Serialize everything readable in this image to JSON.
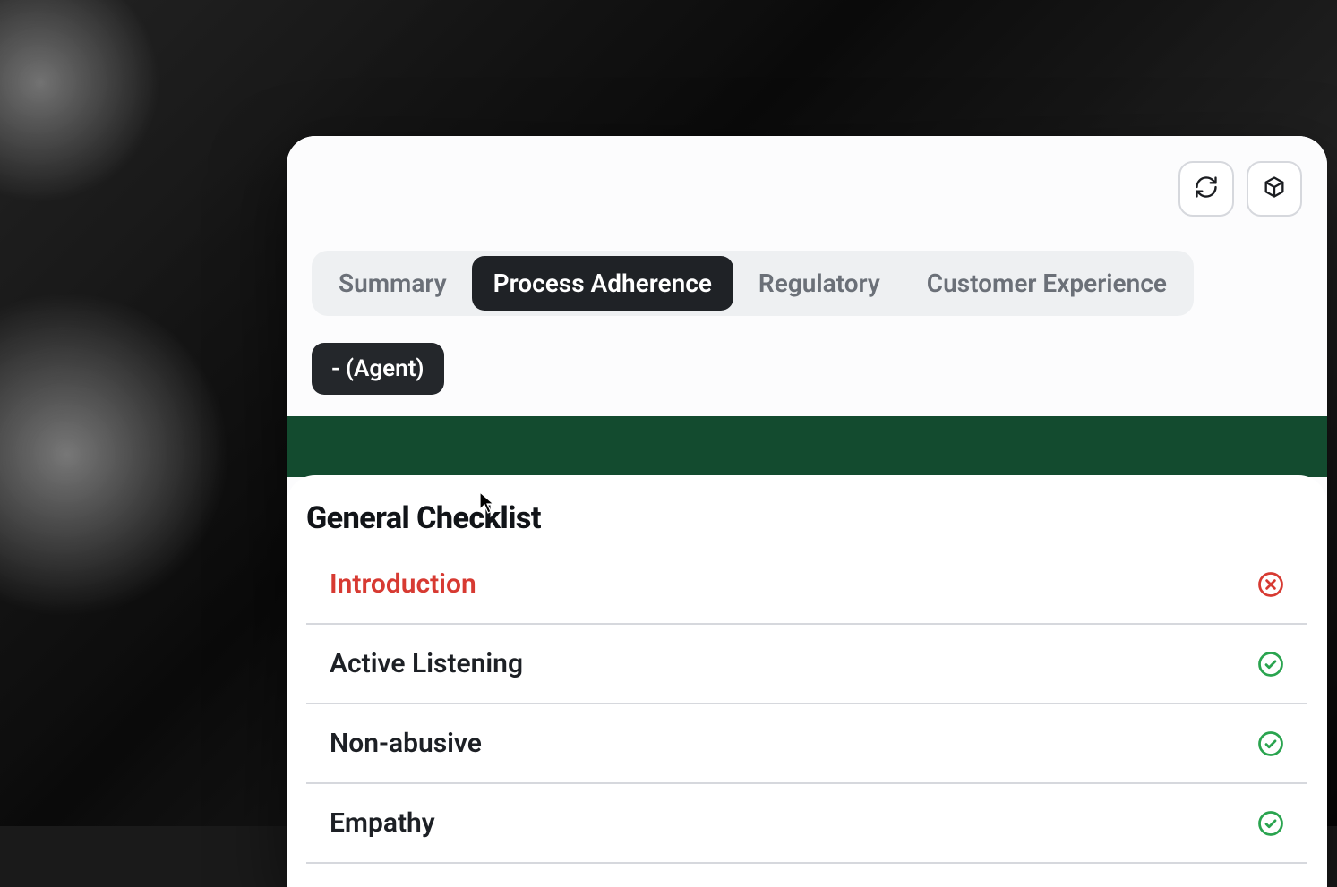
{
  "colors": {
    "accent_green_band": "#134b2f",
    "fail_red": "#d73a32",
    "pass_green": "#2aa44f",
    "tab_active_bg": "#1f2226"
  },
  "header": {
    "actions": {
      "refresh_icon": "refresh-icon",
      "export_icon": "package-icon"
    }
  },
  "tabs": [
    {
      "id": "summary",
      "label": "Summary",
      "active": false
    },
    {
      "id": "process",
      "label": "Process Adherence",
      "active": true
    },
    {
      "id": "regulatory",
      "label": "Regulatory",
      "active": false
    },
    {
      "id": "cx",
      "label": "Customer Experience",
      "active": false
    }
  ],
  "agent_chip": {
    "label": "- (Agent)"
  },
  "checklist": {
    "title": "General Checklist",
    "items": [
      {
        "label": "Introduction",
        "status": "fail"
      },
      {
        "label": "Active Listening",
        "status": "pass"
      },
      {
        "label": "Non-abusive",
        "status": "pass"
      },
      {
        "label": "Empathy",
        "status": "pass"
      }
    ]
  }
}
